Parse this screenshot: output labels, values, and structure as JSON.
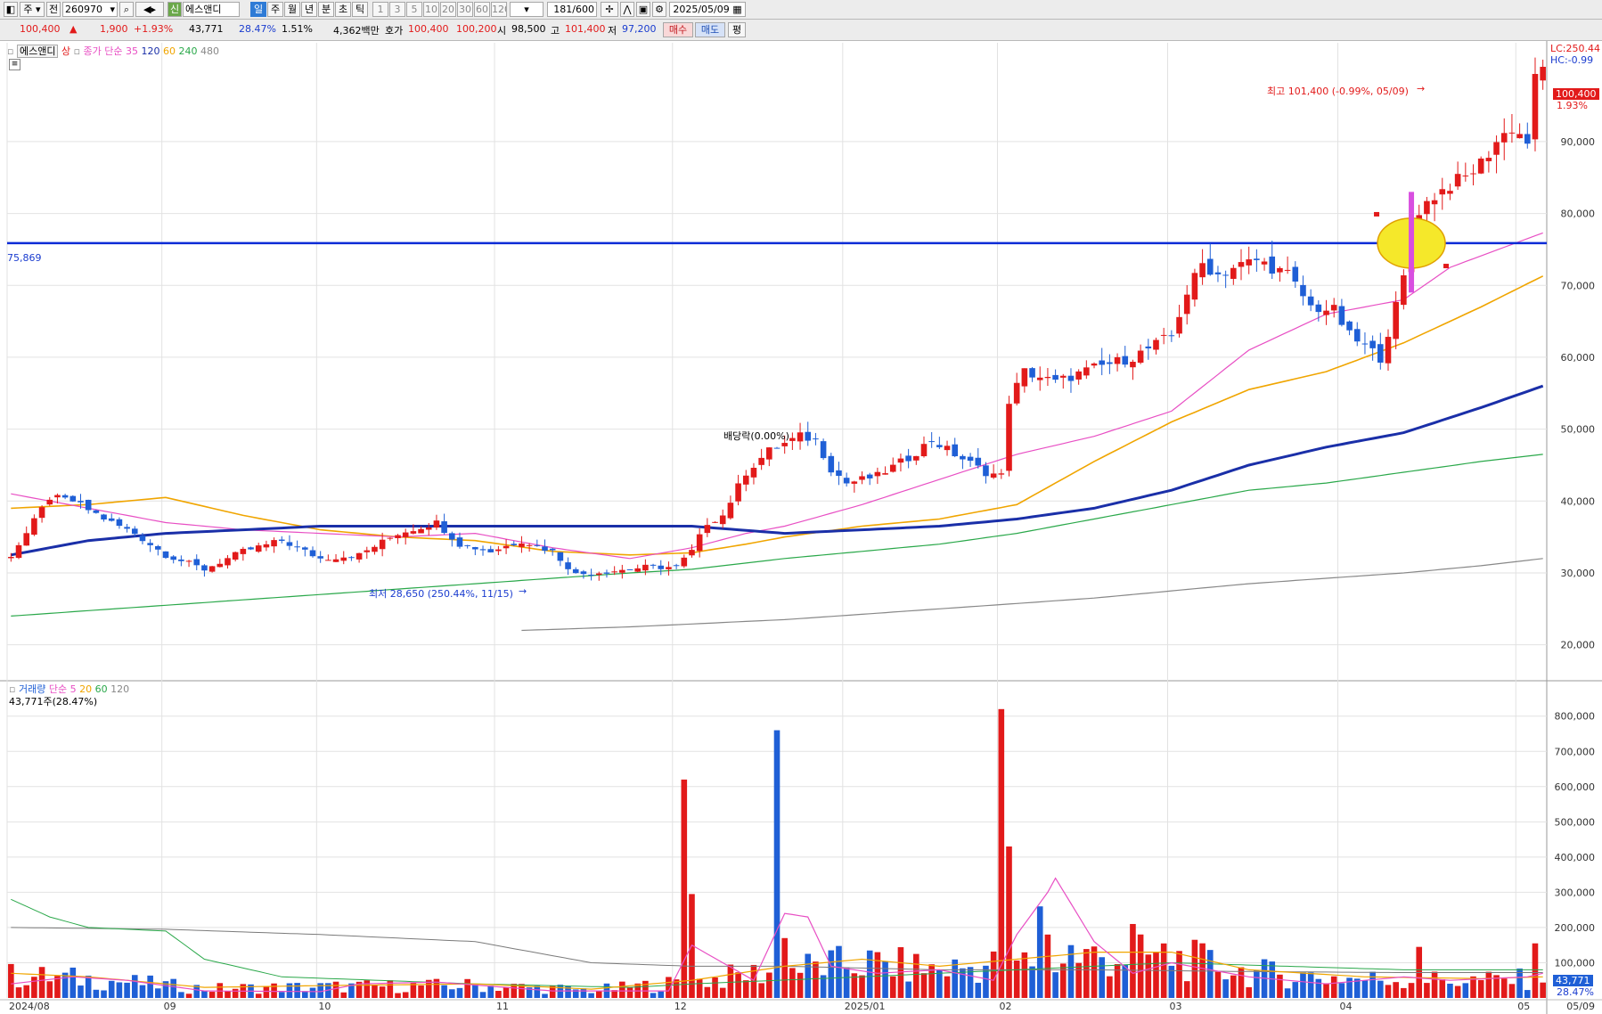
{
  "toolbar": {
    "period_select": "주",
    "compare_label": "전",
    "code": "260970",
    "credit_tag": "신",
    "stock_name": "에스앤디",
    "periods": [
      "일",
      "주",
      "월",
      "년",
      "분",
      "초",
      "틱"
    ],
    "selected_period": "일",
    "intervals": [
      "1",
      "3",
      "5",
      "10",
      "20",
      "30",
      "60",
      "120"
    ],
    "count": "181",
    "count_max": "/600",
    "date": "2025/05/09"
  },
  "quote": {
    "price": "100,400",
    "change": "1,900",
    "change_pct": "+1.93%",
    "volume": "43,771",
    "volume_ratio": "28.47%",
    "turnover_rate": "1.51%",
    "amount": "4,362백만",
    "ask_label": "호가",
    "ask": "100,400",
    "bid": "100,200",
    "open_label": "시",
    "open": "98,500",
    "high_label": "고",
    "high": "101,400",
    "low_label": "저",
    "low": "97,200",
    "buy_button": "매수",
    "sell_button": "매도",
    "eval_button": "평"
  },
  "price_legend": {
    "name": "에스앤디",
    "tag": "상",
    "ma_label": "종가 단순",
    "ma_periods": [
      "35",
      "120",
      "60",
      "240",
      "480"
    ]
  },
  "volume_legend": {
    "label": "거래량",
    "ma_label": "단순",
    "periods": [
      "5",
      "20",
      "60",
      "120"
    ],
    "current": "43,771주(28.47%)"
  },
  "annotations": {
    "lc": "LC:250.44",
    "hc": "HC:-0.99",
    "high_note": "최고 101,400 (-0.99%, 05/09)",
    "low_note": "최저 28,650 (250.44%, 11/15)",
    "dividend": "배당락(0.00%)",
    "hline_value": "75,869",
    "last_price": "100,400",
    "last_pct": "1.93%",
    "last_volume": "43,771",
    "last_volume_pct": "28.47%"
  },
  "colors": {
    "up": "#e21a1a",
    "down": "#1f5fd6",
    "ma35": "#e84fc4",
    "ma120": "#1a2fa8",
    "ma60": "#f0a500",
    "ma240": "#2aa84a",
    "ma480": "#888888",
    "hline": "#0a2bd6"
  },
  "chart_data": {
    "type": "candlestick",
    "price_axis": {
      "ticks": [
        "20,000",
        "30,000",
        "40,000",
        "50,000",
        "60,000",
        "70,000",
        "80,000",
        "90,000"
      ],
      "range": [
        15000,
        103000
      ]
    },
    "volume_axis": {
      "ticks": [
        "100,000",
        "200,000",
        "300,000",
        "400,000",
        "500,000",
        "600,000",
        "700,000",
        "800,000"
      ],
      "range": [
        0,
        860000
      ]
    },
    "date_ticks": [
      {
        "label": "2024/08",
        "i": 0
      },
      {
        "label": "09",
        "i": 20
      },
      {
        "label": "10",
        "i": 40
      },
      {
        "label": "11",
        "i": 63
      },
      {
        "label": "12",
        "i": 86
      },
      {
        "label": "2025/01",
        "i": 108
      },
      {
        "label": "02",
        "i": 128
      },
      {
        "label": "03",
        "i": 150
      },
      {
        "label": "04",
        "i": 172
      },
      {
        "label": "05",
        "i": 195
      },
      {
        "label": "05/09",
        "i": 198
      }
    ],
    "hline": 75869,
    "highlight_index": 181,
    "candle_count": 199,
    "anchors": [
      [
        0,
        32500
      ],
      [
        2,
        35500
      ],
      [
        5,
        40500
      ],
      [
        8,
        40000
      ],
      [
        13,
        37000
      ],
      [
        16,
        35500
      ],
      [
        20,
        32500
      ],
      [
        25,
        30500
      ],
      [
        30,
        33000
      ],
      [
        35,
        34500
      ],
      [
        40,
        32000
      ],
      [
        45,
        32500
      ],
      [
        50,
        35500
      ],
      [
        55,
        37000
      ],
      [
        58,
        34000
      ],
      [
        62,
        33000
      ],
      [
        66,
        34500
      ],
      [
        70,
        33000
      ],
      [
        73,
        29800
      ],
      [
        78,
        30300
      ],
      [
        82,
        30800
      ],
      [
        86,
        30800
      ],
      [
        88,
        33000
      ],
      [
        90,
        37000
      ],
      [
        92,
        38000
      ],
      [
        95,
        44000
      ],
      [
        98,
        47000
      ],
      [
        100,
        48000
      ],
      [
        102,
        49000
      ],
      [
        104,
        48500
      ],
      [
        106,
        44500
      ],
      [
        108,
        42500
      ],
      [
        112,
        43500
      ],
      [
        116,
        46000
      ],
      [
        119,
        48500
      ],
      [
        122,
        46500
      ],
      [
        126,
        44000
      ],
      [
        128,
        43500
      ],
      [
        129,
        54000
      ],
      [
        131,
        58000
      ],
      [
        135,
        56500
      ],
      [
        140,
        58500
      ],
      [
        145,
        60000
      ],
      [
        150,
        63000
      ],
      [
        152,
        69000
      ],
      [
        154,
        73000
      ],
      [
        156,
        71500
      ],
      [
        158,
        72500
      ],
      [
        161,
        73500
      ],
      [
        165,
        71500
      ],
      [
        168,
        67000
      ],
      [
        171,
        66500
      ],
      [
        173,
        63000
      ],
      [
        175,
        61500
      ],
      [
        177,
        60000
      ],
      [
        179,
        67000
      ],
      [
        181,
        75000
      ],
      [
        182,
        80500
      ],
      [
        184,
        82500
      ],
      [
        186,
        84000
      ],
      [
        188,
        85000
      ],
      [
        190,
        87000
      ],
      [
        192,
        90000
      ],
      [
        194,
        92000
      ],
      [
        196,
        90000
      ],
      [
        197,
        98500
      ],
      [
        198,
        100400
      ]
    ],
    "spikes": [
      [
        87,
        620000
      ],
      [
        88,
        295000
      ],
      [
        99,
        760000
      ],
      [
        100,
        170000
      ],
      [
        128,
        820000
      ],
      [
        129,
        430000
      ],
      [
        133,
        260000
      ],
      [
        134,
        180000
      ],
      [
        137,
        150000
      ],
      [
        145,
        210000
      ],
      [
        182,
        145000
      ],
      [
        197,
        155000
      ],
      [
        198,
        43771
      ]
    ],
    "ma_anchors": {
      "ma35": [
        [
          0,
          41000
        ],
        [
          10,
          39000
        ],
        [
          20,
          37000
        ],
        [
          30,
          36000
        ],
        [
          40,
          35500
        ],
        [
          50,
          35000
        ],
        [
          60,
          35500
        ],
        [
          70,
          33500
        ],
        [
          80,
          32000
        ],
        [
          88,
          33500
        ],
        [
          95,
          35500
        ],
        [
          100,
          36500
        ],
        [
          110,
          39500
        ],
        [
          120,
          43000
        ],
        [
          130,
          46500
        ],
        [
          140,
          49000
        ],
        [
          150,
          52500
        ],
        [
          160,
          61000
        ],
        [
          170,
          66000
        ],
        [
          180,
          68000
        ],
        [
          186,
          72500
        ],
        [
          198,
          77300
        ]
      ],
      "ma60": [
        [
          0,
          39000
        ],
        [
          10,
          39500
        ],
        [
          20,
          40500
        ],
        [
          30,
          38000
        ],
        [
          40,
          36000
        ],
        [
          50,
          35000
        ],
        [
          60,
          34500
        ],
        [
          70,
          33000
        ],
        [
          80,
          32500
        ],
        [
          88,
          32800
        ],
        [
          95,
          34000
        ],
        [
          100,
          35000
        ],
        [
          110,
          36500
        ],
        [
          120,
          37500
        ],
        [
          130,
          39500
        ],
        [
          140,
          45500
        ],
        [
          150,
          51000
        ],
        [
          160,
          55500
        ],
        [
          170,
          58000
        ],
        [
          180,
          62000
        ],
        [
          190,
          67000
        ],
        [
          198,
          71300
        ]
      ],
      "ma120": [
        [
          0,
          32500
        ],
        [
          10,
          34500
        ],
        [
          20,
          35500
        ],
        [
          30,
          36000
        ],
        [
          40,
          36500
        ],
        [
          50,
          36500
        ],
        [
          60,
          36500
        ],
        [
          70,
          36500
        ],
        [
          80,
          36500
        ],
        [
          88,
          36500
        ],
        [
          100,
          35500
        ],
        [
          110,
          36000
        ],
        [
          120,
          36500
        ],
        [
          130,
          37500
        ],
        [
          140,
          39000
        ],
        [
          150,
          41500
        ],
        [
          160,
          45000
        ],
        [
          170,
          47500
        ],
        [
          180,
          49500
        ],
        [
          190,
          53000
        ],
        [
          198,
          56000
        ]
      ],
      "ma240": [
        [
          0,
          24000
        ],
        [
          20,
          25500
        ],
        [
          40,
          27000
        ],
        [
          60,
          28500
        ],
        [
          80,
          30000
        ],
        [
          88,
          30500
        ],
        [
          100,
          32000
        ],
        [
          110,
          33000
        ],
        [
          120,
          34000
        ],
        [
          130,
          35500
        ],
        [
          140,
          37500
        ],
        [
          150,
          39500
        ],
        [
          160,
          41500
        ],
        [
          170,
          42500
        ],
        [
          180,
          44000
        ],
        [
          190,
          45500
        ],
        [
          198,
          46500
        ]
      ],
      "ma480": [
        [
          66,
          22000
        ],
        [
          80,
          22500
        ],
        [
          100,
          23500
        ],
        [
          120,
          25000
        ],
        [
          140,
          26500
        ],
        [
          160,
          28500
        ],
        [
          180,
          30000
        ],
        [
          190,
          31000
        ],
        [
          198,
          32000
        ]
      ],
      "vol5": [
        [
          0,
          40000
        ],
        [
          8,
          60000
        ],
        [
          15,
          50000
        ],
        [
          25,
          20000
        ],
        [
          40,
          18000
        ],
        [
          45,
          40000
        ],
        [
          55,
          45000
        ],
        [
          70,
          20000
        ],
        [
          85,
          20000
        ],
        [
          88,
          150000
        ],
        [
          92,
          100000
        ],
        [
          96,
          50000
        ],
        [
          100,
          240000
        ],
        [
          103,
          230000
        ],
        [
          106,
          90000
        ],
        [
          112,
          70000
        ],
        [
          120,
          80000
        ],
        [
          127,
          50000
        ],
        [
          130,
          180000
        ],
        [
          134,
          300000
        ],
        [
          135,
          340000
        ],
        [
          140,
          160000
        ],
        [
          145,
          70000
        ],
        [
          150,
          100000
        ],
        [
          160,
          60000
        ],
        [
          170,
          40000
        ],
        [
          180,
          60000
        ],
        [
          186,
          50000
        ],
        [
          196,
          60000
        ],
        [
          198,
          70000
        ]
      ],
      "vol20": [
        [
          0,
          70000
        ],
        [
          10,
          60000
        ],
        [
          25,
          30000
        ],
        [
          40,
          35000
        ],
        [
          60,
          40000
        ],
        [
          75,
          25000
        ],
        [
          88,
          50000
        ],
        [
          100,
          90000
        ],
        [
          110,
          110000
        ],
        [
          120,
          90000
        ],
        [
          130,
          110000
        ],
        [
          140,
          130000
        ],
        [
          150,
          130000
        ],
        [
          160,
          80000
        ],
        [
          175,
          60000
        ],
        [
          190,
          55000
        ],
        [
          198,
          60000
        ]
      ],
      "vol60": [
        [
          0,
          280000
        ],
        [
          5,
          230000
        ],
        [
          10,
          200000
        ],
        [
          20,
          190000
        ],
        [
          25,
          110000
        ],
        [
          35,
          60000
        ],
        [
          60,
          40000
        ],
        [
          80,
          30000
        ],
        [
          88,
          40000
        ],
        [
          110,
          60000
        ],
        [
          130,
          80000
        ],
        [
          150,
          100000
        ],
        [
          165,
          90000
        ],
        [
          180,
          80000
        ],
        [
          198,
          80000
        ]
      ],
      "vol120": [
        [
          0,
          200000
        ],
        [
          20,
          195000
        ],
        [
          40,
          180000
        ],
        [
          60,
          160000
        ],
        [
          75,
          100000
        ],
        [
          88,
          90000
        ],
        [
          100,
          90000
        ],
        [
          110,
          85000
        ],
        [
          120,
          80000
        ],
        [
          140,
          80000
        ],
        [
          160,
          75000
        ],
        [
          180,
          72000
        ],
        [
          198,
          72000
        ]
      ]
    }
  }
}
